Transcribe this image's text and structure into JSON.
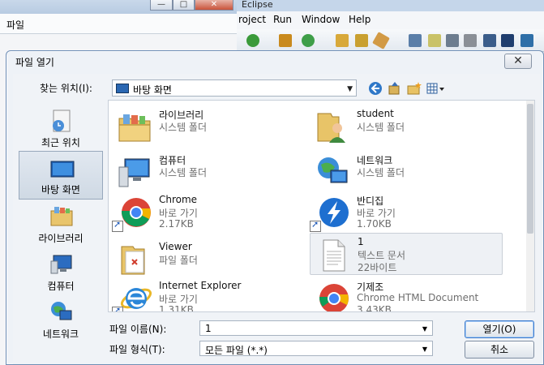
{
  "bg_window": {
    "menu_label": "파일"
  },
  "eclipse": {
    "title": "Eclipse",
    "menu": [
      {
        "label": "roject"
      },
      {
        "label": "Run"
      },
      {
        "label": "Window"
      },
      {
        "label": "Help"
      }
    ]
  },
  "dialog": {
    "title": "파일 열기",
    "close_label": "✕",
    "look_in": {
      "label": "찾는 위치(I):",
      "value": "바탕 화면"
    },
    "nav": [
      {
        "label": "최근 위치",
        "icon": "recent-places-icon"
      },
      {
        "label": "바탕 화면",
        "icon": "desktop-icon"
      },
      {
        "label": "라이브러리",
        "icon": "libraries-icon"
      },
      {
        "label": "컴퓨터",
        "icon": "computer-icon"
      },
      {
        "label": "네트워크",
        "icon": "network-icon"
      }
    ],
    "files": [
      {
        "name": "라이브러리",
        "type": "시스템 폴더",
        "size": "",
        "icon": "libraries-folder-icon"
      },
      {
        "name": "student",
        "type": "시스템 폴더",
        "size": "",
        "icon": "user-folder-icon"
      },
      {
        "name": "컴퓨터",
        "type": "시스템 폴더",
        "size": "",
        "icon": "computer-icon"
      },
      {
        "name": "네트워크",
        "type": "시스템 폴더",
        "size": "",
        "icon": "network-icon"
      },
      {
        "name": "Chrome",
        "type": "바로 가기",
        "size": "2.17KB",
        "icon": "chrome-icon"
      },
      {
        "name": "반디집",
        "type": "바로 가기",
        "size": "1.70KB",
        "icon": "bandizip-icon"
      },
      {
        "name": "Viewer",
        "type": "파일 폴더",
        "size": "",
        "icon": "folder-icon"
      },
      {
        "name": "1",
        "type": "텍스트 문서",
        "size": "22바이트",
        "icon": "text-file-icon"
      },
      {
        "name": "Internet Explorer",
        "type": "바로 가기",
        "size": "1.31KB",
        "icon": "internet-explorer-icon"
      },
      {
        "name": "기제조",
        "type": "Chrome HTML Document",
        "size": "3.43KB",
        "icon": "chrome-icon"
      }
    ],
    "file_name": {
      "label": "파일 이름(N):",
      "value": "1"
    },
    "file_type": {
      "label": "파일 형식(T):",
      "value": "모든 파일 (*.*)"
    },
    "open_label": "열기(O)",
    "cancel_label": "취소"
  }
}
